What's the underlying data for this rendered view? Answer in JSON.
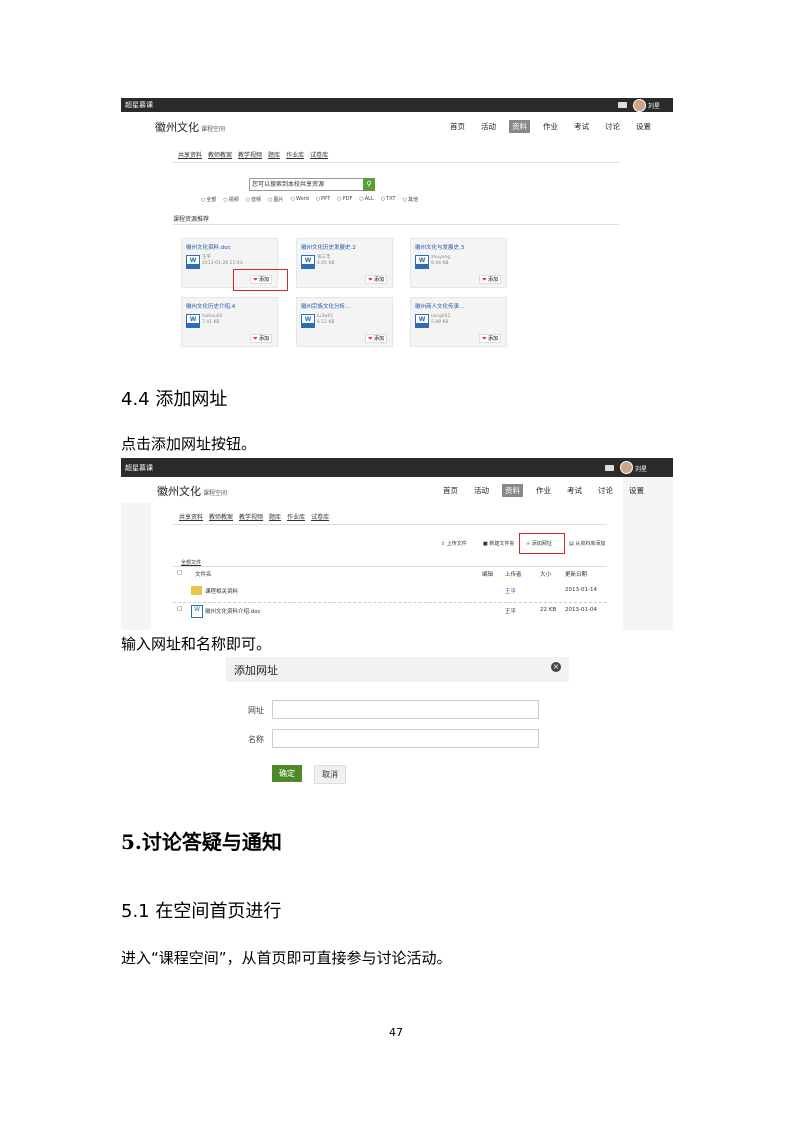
{
  "shot1": {
    "brand": "超星慕课",
    "user": "刘星",
    "course_title": "徽州文化",
    "course_sub": "课程空间",
    "nav": [
      "首页",
      "活动",
      "资料",
      "作业",
      "考试",
      "讨论",
      "设置"
    ],
    "subnav": [
      "共享资料",
      "教师教案",
      "教学视频",
      "题库",
      "作业库",
      "试卷库"
    ],
    "search_value": "您可以搜索到本校共享资源",
    "filters": [
      "全部",
      "视频",
      "音频",
      "图片",
      "Word",
      "PPT",
      "PDF",
      "ALL",
      "TXT",
      "其他"
    ],
    "section_label": "课程资源推荐",
    "cards": [
      {
        "title": "徽州文化资料.doc",
        "meta1": "王平",
        "meta2": "2013-01-28 21:43",
        "fav": "添加"
      },
      {
        "title": "徽州文化历史发展史.2",
        "meta1": "张三丰",
        "meta2": "4.05 KB",
        "fav": "添加"
      },
      {
        "title": "徽州文化与发展史.3",
        "meta1": "zhuyong",
        "meta2": "8.44 KB",
        "fav": "添加"
      },
      {
        "title": "徽州文化历史介绍.4",
        "meta1": "lazhou02",
        "meta2": "7.41 KB",
        "fav": "添加"
      },
      {
        "title": "徽州宗族文化分析...",
        "meta1": "lu3w01",
        "meta2": "6.12 KB",
        "fav": "添加"
      },
      {
        "title": "徽州商人文化传承...",
        "meta1": "laingli02",
        "meta2": "5.88 KB",
        "fav": "添加"
      }
    ]
  },
  "h44": "4.4 添加网址",
  "p1": "点击添加网址按钮。",
  "shot2": {
    "brand": "超星慕课",
    "user": "刘星",
    "course_title": "徽州文化",
    "course_sub": "课程空间",
    "nav": [
      "首页",
      "活动",
      "资料",
      "作业",
      "考试",
      "讨论",
      "设置"
    ],
    "subnav": [
      "共享资料",
      "教师教案",
      "教学视频",
      "题库",
      "作业库",
      "试卷库"
    ],
    "toolbar": [
      "上传文件",
      "新建文件夹",
      "添加网址",
      "从资料库添加"
    ],
    "breadcrumb": "全部文件",
    "columns": [
      "文件名",
      "编辑",
      "上传者",
      "大小",
      "更新日期"
    ],
    "rows": [
      {
        "name": "课程相关资料",
        "owner": "王平",
        "size": "",
        "date": "2013-01-14"
      },
      {
        "name": "徽州文化资料介绍.doc",
        "owner": "王平",
        "size": "22 KB",
        "date": "2013-01-04"
      }
    ]
  },
  "p2": "输入网址和名称即可。",
  "dialog": {
    "title": "添加网址",
    "label_url": "网址",
    "label_name": "名称",
    "ok": "确定",
    "cancel": "取消"
  },
  "h5": "5.讨论答疑与通知",
  "h51": "5.1 在空间首页进行",
  "p3": "进入“课程空间”，从首页即可直接参与讨论活动。",
  "page_number": "47",
  "colors": {
    "accent_green": "#4f8a2a",
    "highlight_red": "#d8262f",
    "topbar": "#2b2b2b"
  }
}
